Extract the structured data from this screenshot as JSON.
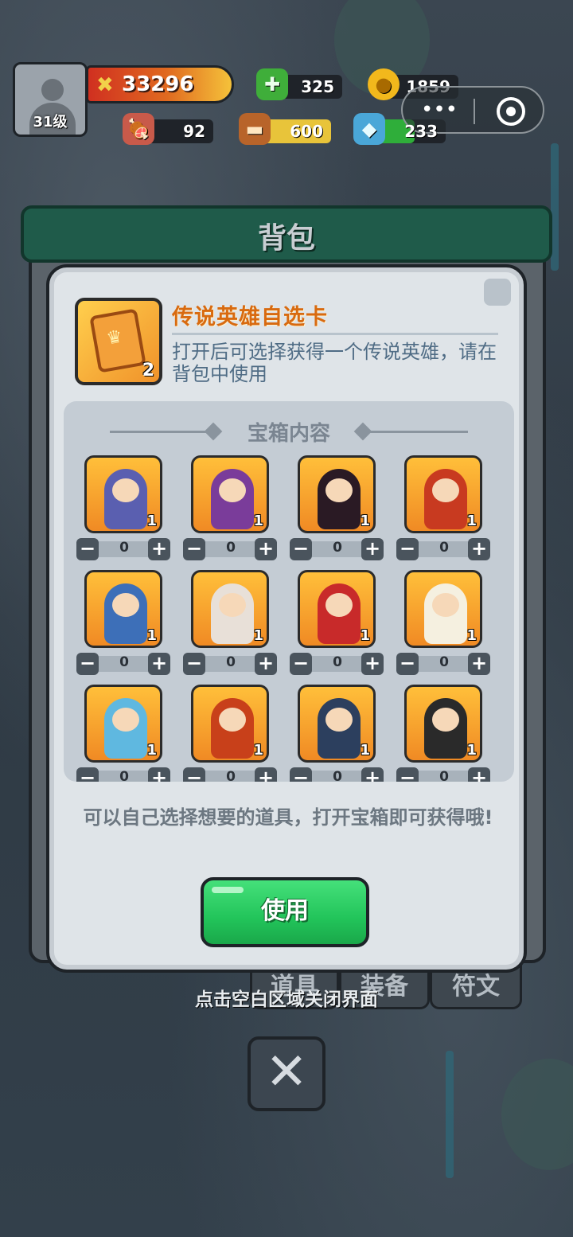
{
  "hud": {
    "level": "31级",
    "power": "33296",
    "resources": {
      "gems": "325",
      "gold": "1859",
      "meat": "92",
      "wood": "600",
      "crystal": "233"
    },
    "icons": {
      "power": "crossed-swords-icon",
      "gems": "green-gem-plus-icon",
      "gold": "gold-coin-icon",
      "meat": "meat-icon",
      "wood": "wood-log-icon",
      "crystal": "blue-crystal-icon"
    }
  },
  "capsule": {
    "more": "•••",
    "close": "target-icon"
  },
  "bag": {
    "title": "背包",
    "tabs": [
      "道具",
      "装备",
      "符文"
    ]
  },
  "dialog": {
    "item_title": "传说英雄自选卡",
    "item_desc": "打开后可选择获得一个传说英雄，请在背包中使用",
    "item_count": "2",
    "chest_title": "宝箱内容",
    "heroes": [
      {
        "name": "wizard",
        "count": "1",
        "qty": "0",
        "color": "#5a5fb0"
      },
      {
        "name": "warrior-woman",
        "count": "1",
        "qty": "0",
        "color": "#7a3c9a"
      },
      {
        "name": "vampire",
        "count": "1",
        "qty": "0",
        "color": "#2a1a24"
      },
      {
        "name": "red-hair-swordswoman",
        "count": "1",
        "qty": "0",
        "color": "#c83a20"
      },
      {
        "name": "ice-knight",
        "count": "1",
        "qty": "0",
        "color": "#3d6fb8"
      },
      {
        "name": "fox-girl",
        "count": "1",
        "qty": "0",
        "color": "#e8e0d8"
      },
      {
        "name": "samurai",
        "count": "1",
        "qty": "0",
        "color": "#c82a2a"
      },
      {
        "name": "angel",
        "count": "1",
        "qty": "0",
        "color": "#f5f0e0"
      },
      {
        "name": "ice-mage",
        "count": "1",
        "qty": "0",
        "color": "#5fb8e0"
      },
      {
        "name": "fire-mage",
        "count": "1",
        "qty": "0",
        "color": "#c8401a"
      },
      {
        "name": "dark-knight",
        "count": "1",
        "qty": "0",
        "color": "#2c3f5e"
      },
      {
        "name": "panda",
        "count": "1",
        "qty": "0",
        "color": "#2a2a2a"
      }
    ],
    "hint": "可以自己选择想要的道具，打开宝箱即可获得哦!",
    "use_label": "使用"
  },
  "close_hint": "点击空白区域关闭界面",
  "close_label": "✕"
}
